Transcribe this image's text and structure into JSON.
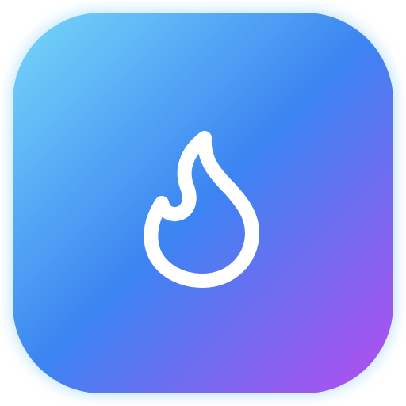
{
  "app_icon": {
    "icon": "flame-icon",
    "gradient": {
      "top_left": "#76D8F8",
      "middle": "#3C84F2",
      "bottom_right": "#B64CEE"
    },
    "glyph_color": "#FFFFFF"
  }
}
